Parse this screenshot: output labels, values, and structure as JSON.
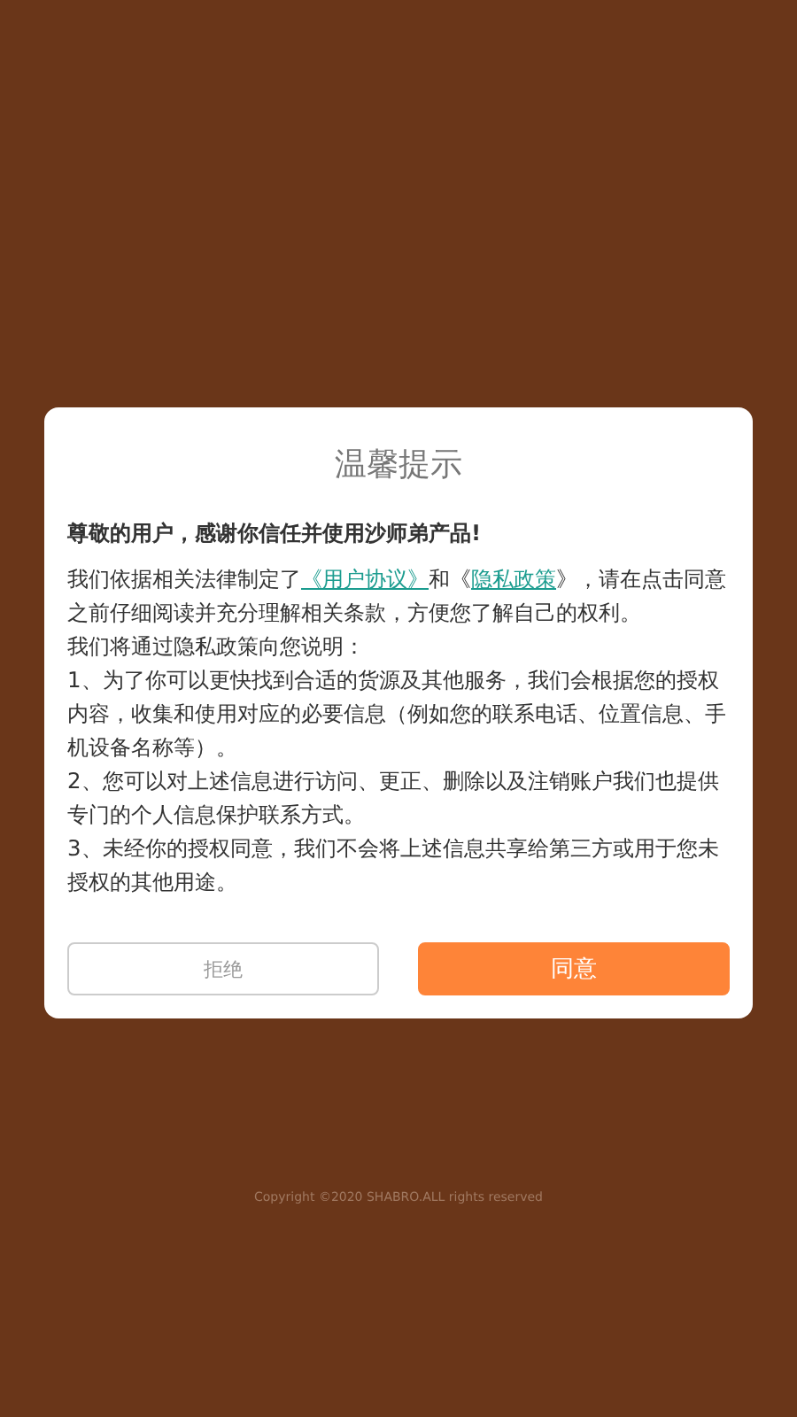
{
  "dialog": {
    "title": "温馨提示",
    "greeting": "尊敬的用户，感谢你信任并使用沙师弟产品!",
    "policy_paragraph": {
      "before": "我们依据相关法律制定了",
      "link_1": "《用户协议》",
      "middle": "和《",
      "link_2": "隐私政策",
      "after": "》，请在点击同意之前仔细阅读并充分理解相关条款，方便您了解自己的权利。"
    },
    "paragraphs": [
      "我们将通过隐私政策向您说明：",
      "1、为了你可以更快找到合适的货源及其他服务，我们会根据您的授权内容，收集和使用对应的必要信息（例如您的联系电话、位置信息、手机设备名称等）。",
      "2、您可以对上述信息进行访问、更正、删除以及注销账户我们也提供专门的个人信息保护联系方式。",
      "3、未经你的授权同意，我们不会将上述信息共享给第三方或用于您未授权的其他用途。"
    ],
    "buttons": [
      {
        "label": "拒绝",
        "kind": "secondary"
      },
      {
        "label": "同意",
        "kind": "primary"
      }
    ]
  },
  "copyright": "Copyright ©2020 SHABRO.ALL rights reserved"
}
